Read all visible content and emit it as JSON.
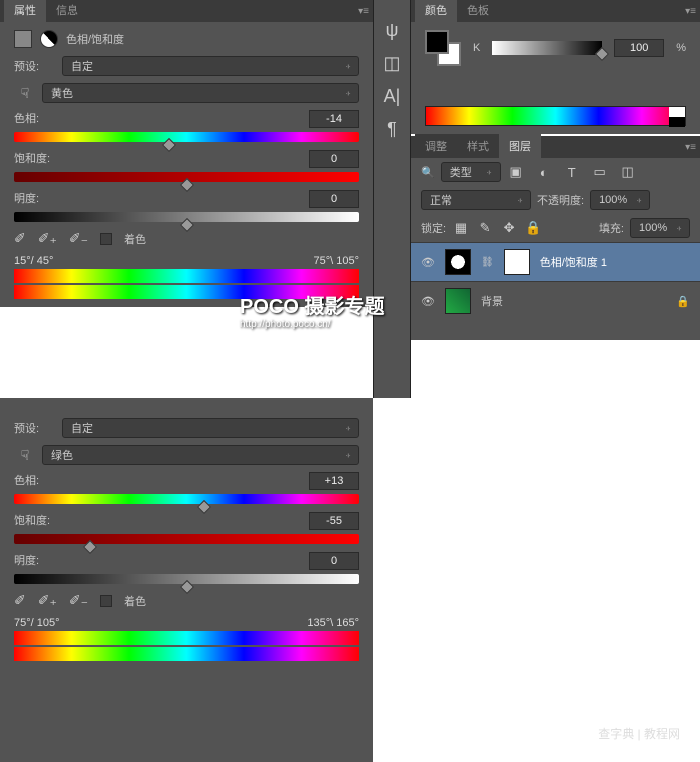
{
  "props_panel": {
    "tabs": [
      "属性",
      "信息"
    ],
    "active_tab": 0,
    "title": "色相/饱和度",
    "preset_label": "预设:",
    "preset_value": "自定",
    "yellow": {
      "channel": "黄色",
      "hue_label": "色相:",
      "hue_value": "-14",
      "sat_label": "饱和度:",
      "sat_value": "0",
      "light_label": "明度:",
      "light_value": "0",
      "colorize_label": "着色",
      "range_low": "15°/ 45°",
      "range_high": "75°\\ 105°"
    },
    "green": {
      "preset_label": "预设:",
      "preset_value": "自定",
      "channel": "绿色",
      "hue_label": "色相:",
      "hue_value": "+13",
      "sat_label": "饱和度:",
      "sat_value": "-55",
      "light_label": "明度:",
      "light_value": "0",
      "colorize_label": "着色",
      "range_low": "75°/ 105°",
      "range_high": "135°\\ 165°"
    }
  },
  "color_panel": {
    "tabs": [
      "颜色",
      "色板"
    ],
    "k_label": "K",
    "k_value": "100",
    "percent": "%"
  },
  "layers_panel": {
    "tabs": [
      "调整",
      "样式",
      "图层"
    ],
    "active_tab": 2,
    "filter": "类型",
    "blend": "正常",
    "opacity_label": "不透明度:",
    "opacity_value": "100%",
    "lock_label": "锁定:",
    "fill_label": "填充:",
    "fill_value": "100%",
    "layers": [
      {
        "name": "色相/饱和度 1"
      },
      {
        "name": "背景"
      }
    ]
  },
  "watermark": {
    "main": "POCO 摄影专题",
    "sub": "http://photo.poco.cn/",
    "corner": "查字典 | 教程网"
  }
}
